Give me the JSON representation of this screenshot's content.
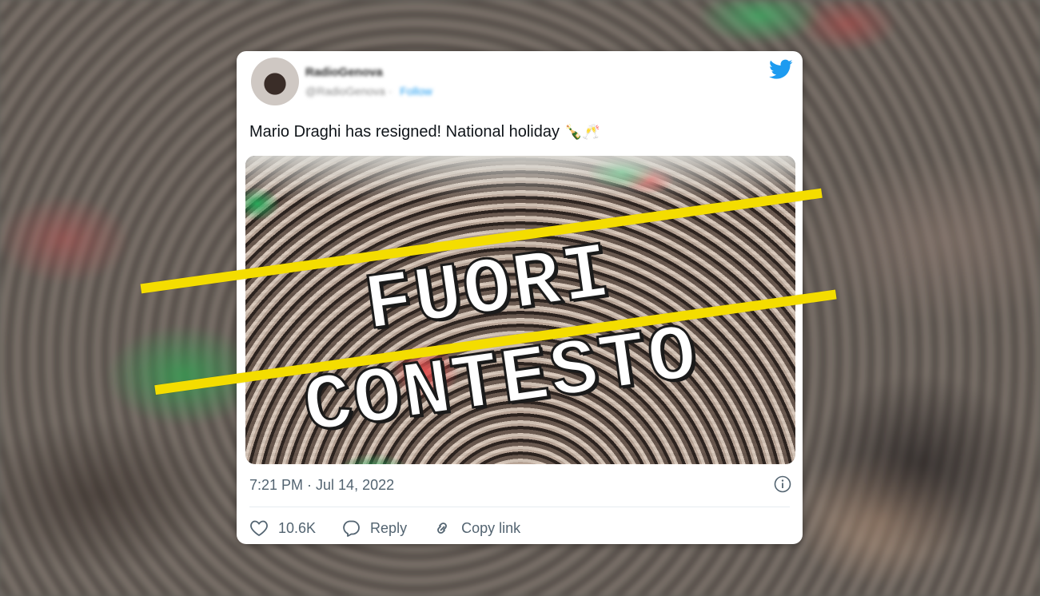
{
  "stamp": {
    "text": "FUORI CONTESTO",
    "color": "#f4dd00"
  },
  "tweet": {
    "username": "RadioGenova",
    "handle": "@RadioGenova",
    "follow_label": "Follow",
    "text": "Mario Draghi has resigned! National holiday",
    "emoji": "🍾🥂",
    "timestamp": "7:21 PM · Jul 14, 2022",
    "likes_count": "10.6K",
    "reply_label": "Reply",
    "copy_link_label": "Copy link",
    "accent_color": "#1d9bf0"
  },
  "icons": [
    "twitter-logo-icon",
    "info-icon",
    "heart-icon",
    "reply-icon",
    "link-icon"
  ]
}
